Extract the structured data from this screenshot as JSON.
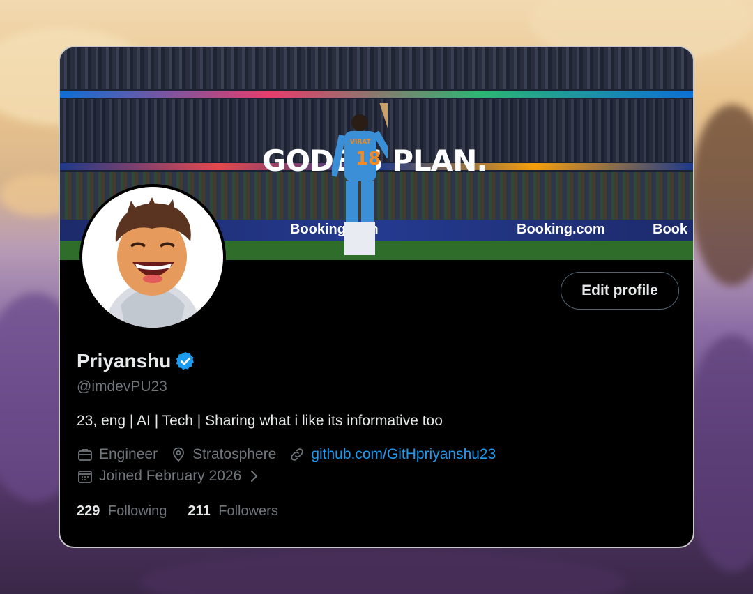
{
  "banner": {
    "headline": "GODE S PLAN.",
    "ads": [
      "Booking.com",
      "Booking.com",
      "Book"
    ],
    "player_name": "VIRAT",
    "player_number": "18"
  },
  "profile": {
    "name": "Priyanshu",
    "verified": true,
    "handle": "@imdevPU23",
    "bio": "23, eng | AI | Tech | Sharing what i like its informative too",
    "profession": "Engineer",
    "location": "Stratosphere",
    "website": "github.com/GitHpriyanshu23",
    "joined": "Joined February 2026",
    "following_count": "229",
    "following_label": "Following",
    "followers_count": "211",
    "followers_label": "Followers"
  },
  "actions": {
    "edit_profile": "Edit profile"
  },
  "colors": {
    "accent": "#1d9bf0",
    "text_primary": "#e7e9ea",
    "text_secondary": "#71767b",
    "background": "#000000"
  },
  "icons": [
    "verified-badge-icon",
    "briefcase-icon",
    "location-pin-icon",
    "link-icon",
    "calendar-icon",
    "chevron-right-icon"
  ]
}
